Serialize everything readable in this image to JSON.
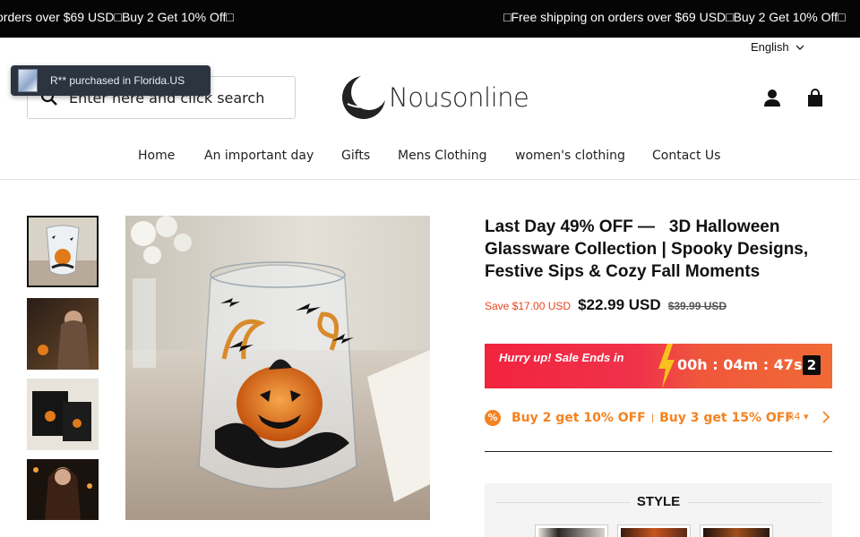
{
  "announcement": {
    "left_text": "orders over $69 USD□Buy 2 Get 10% Off□",
    "right_text": "□Free shipping on orders over $69 USD□Buy 2 Get 10% Off□"
  },
  "header": {
    "language": "English",
    "search_placeholder": "Enter here and click search",
    "logo_text": "Nousonline",
    "account_icon": "user-icon",
    "cart_icon": "shopping-bag-icon"
  },
  "popup": {
    "text": "R** purchased in Florida.US"
  },
  "nav": {
    "items": [
      {
        "label": "Home"
      },
      {
        "label": "An important day"
      },
      {
        "label": "Gifts"
      },
      {
        "label": "Mens Clothing"
      },
      {
        "label": "women's clothing"
      },
      {
        "label": "Contact Us"
      }
    ]
  },
  "product": {
    "title": "Last Day 49% OFF —   3D Halloween Glassware Collection | Spooky Designs, Festive Sips & Cozy Fall Moments",
    "save_label": "Save $17.00 USD",
    "price": "$22.99 USD",
    "compare_price": "$39.99 USD",
    "timer": {
      "label": "Hurry up! Sale Ends in",
      "countdown": "00h : 04m : 47s",
      "seconds_digit": "2"
    },
    "offer": {
      "badge": "%",
      "part1": "Buy 2 get 10% OFF",
      "separator": "|",
      "part2": "Buy 3 get 15% OFF",
      "count": "x4"
    },
    "style_label": "STYLE"
  },
  "colors": {
    "accent_orange": "#f58220",
    "save_red": "#e5451f",
    "timer_red": "#f2233f"
  }
}
